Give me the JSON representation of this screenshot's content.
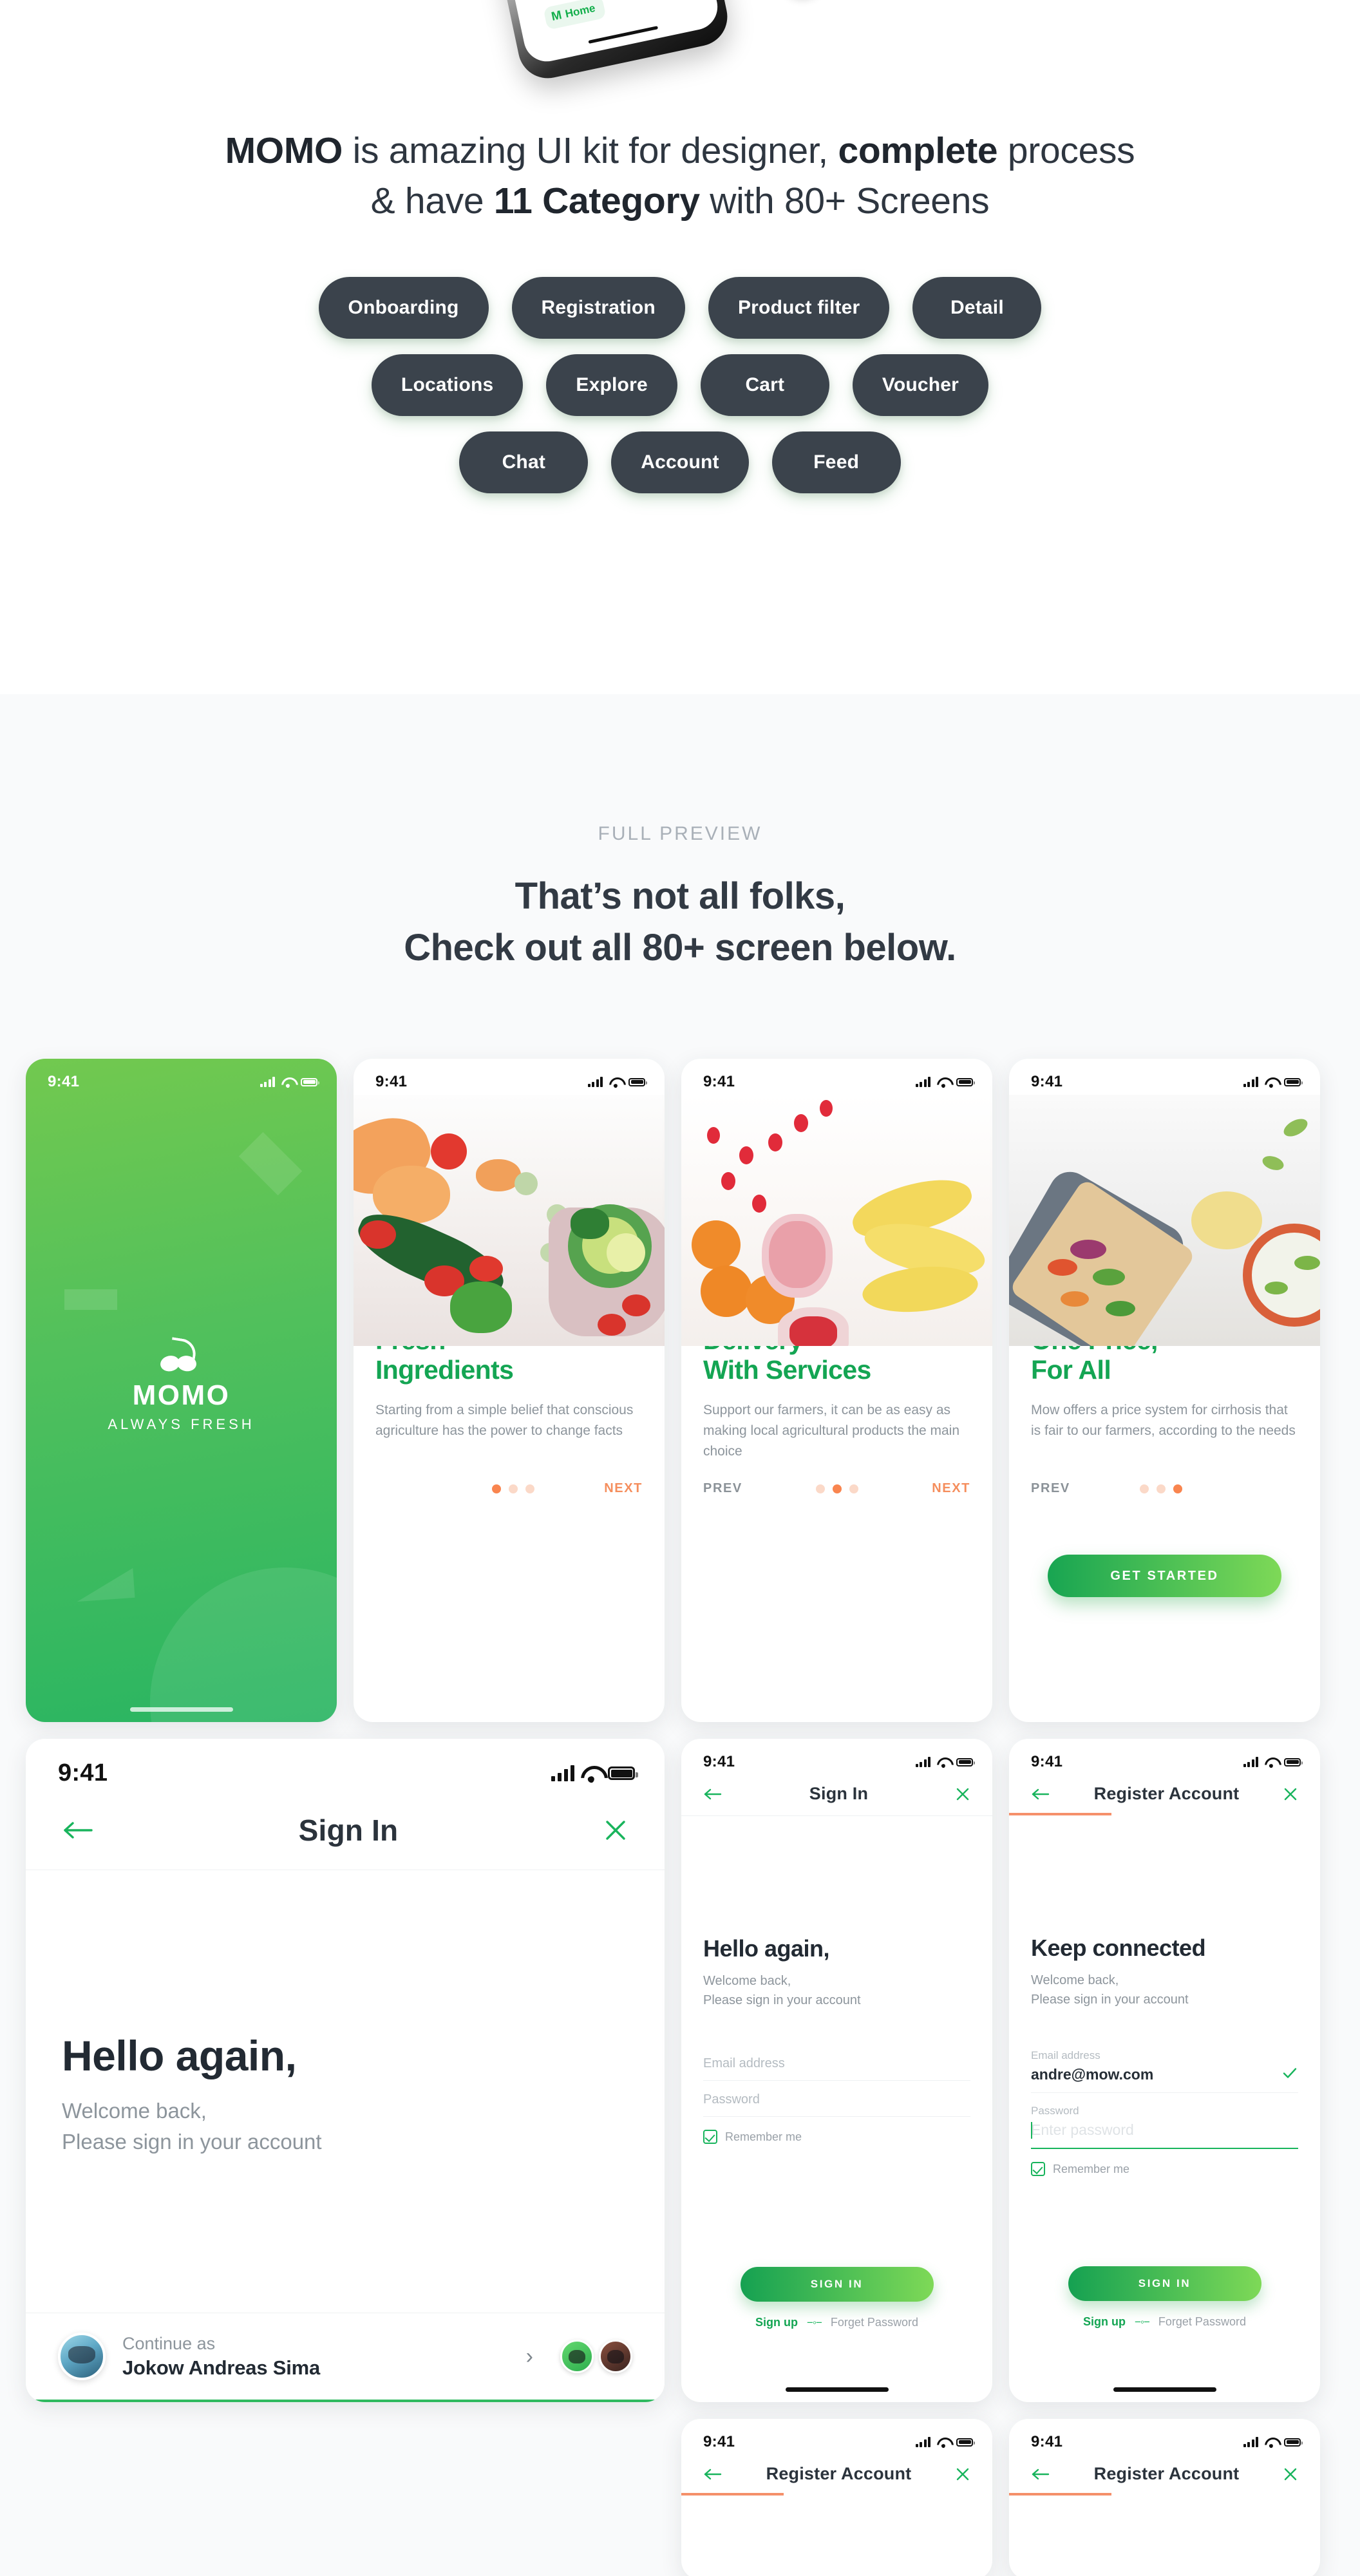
{
  "hero": {
    "device_chip_letter": "M",
    "device_chip_label": "Home",
    "tagline_part1": "MOMO",
    "tagline_part2": " is amazing UI kit  for designer, ",
    "tagline_bold": "complete",
    "tagline_part3": " process",
    "tagline_line2_part1": "& have ",
    "tagline_line2_bold": "11 Category",
    "tagline_line2_part2": " with 80+ Screens",
    "categories": [
      [
        "Onboarding",
        "Registration",
        "Product filter",
        "Detail"
      ],
      [
        "Locations",
        "Explore",
        "Cart",
        "Voucher"
      ],
      [
        "Chat",
        "Account",
        "Feed"
      ]
    ]
  },
  "preview": {
    "eyebrow": "FULL PREVIEW",
    "title_line1": "That’s not all folks,",
    "title_line2": "Check out all 80+ screen below."
  },
  "status_bar": {
    "time": "9:41"
  },
  "screens": {
    "splash": {
      "brand": "MOMO",
      "tagline": "ALWAYS FRESH"
    },
    "onboarding": [
      {
        "title_line1": "Fresh",
        "title_line2": "Ingredients",
        "desc": "Starting from a simple belief that conscious agriculture has the power to change facts",
        "prev_label": "",
        "next_label": "NEXT",
        "active_dot": 0
      },
      {
        "title_line1": "Delivery",
        "title_line2": "With Services",
        "desc": "Support our farmers, it can be as easy as making local agricultural products the main choice",
        "prev_label": "PREV",
        "next_label": "NEXT",
        "active_dot": 1
      },
      {
        "title_line1": "One Price,",
        "title_line2": "For All",
        "desc": "Mow offers a price system for cirrhosis that is fair to our farmers, according to the needs",
        "prev_label": "PREV",
        "next_label": "",
        "active_dot": 2,
        "cta_label": "GET STARTED"
      }
    ],
    "signin_large": {
      "nav_title": "Sign In",
      "heading": "Hello again,",
      "sub_line1": "Welcome back,",
      "sub_line2": "Please sign in your account",
      "continue_label": "Continue as",
      "continue_name": "Jokow Andreas Sima"
    },
    "signin_small": {
      "nav_title": "Sign In",
      "heading": "Hello again,",
      "sub_line1": "Welcome back,",
      "sub_line2": "Please sign in your account",
      "email_label": "Email address",
      "password_label": "Password",
      "remember_label": "Remember me",
      "submit_label": "SIGN IN",
      "signup_label": "Sign up",
      "forgot_label": "Forget Password"
    },
    "register": {
      "nav_title": "Register Account",
      "heading": "Keep connected",
      "sub_line1": "Welcome back,",
      "sub_line2": "Please sign in your account",
      "email_label": "Email address",
      "email_value": "andre@mow.com",
      "password_label": "Password",
      "password_placeholder": "Enter password",
      "remember_label": "Remember me",
      "submit_label": "SIGN IN",
      "signup_label": "Sign up",
      "forgot_label": "Forget Password"
    },
    "register_stub_a": {
      "nav_title": "Register Account"
    },
    "register_stub_b": {
      "nav_title": "Register Account"
    }
  },
  "colors": {
    "brand_green": "#14a553",
    "accent_orange": "#f9854f",
    "dark_pill": "#3b434c",
    "section_bg": "#f9fafb",
    "muted_text": "#8d959c"
  }
}
